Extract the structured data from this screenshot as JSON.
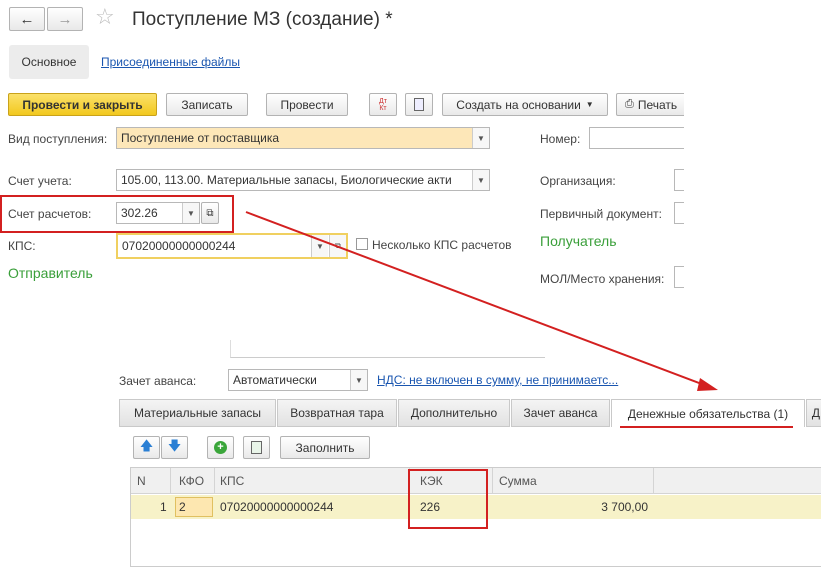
{
  "window": {
    "title": "Поступление МЗ (создание) *"
  },
  "tabs_top": {
    "main": "Основное",
    "files": "Присоединенные файлы"
  },
  "toolbar": {
    "post_close": "Провести и закрыть",
    "save": "Записать",
    "post": "Провести",
    "create_based": "Создать на основании",
    "print": "Печать"
  },
  "form": {
    "receipt_type_label": "Вид поступления:",
    "receipt_type_value": "Поступление от поставщика",
    "account_label": "Счет учета:",
    "account_value": "105.00, 113.00. Материальные запасы, Биологические акти",
    "settle_label": "Счет расчетов:",
    "settle_value": "302.26",
    "kps_label": "КПС:",
    "kps_value": "07020000000000244",
    "multi_kps_label": "Несколько КПС расчетов",
    "sender_label": "Отправитель",
    "number_label": "Номер:",
    "org_label": "Организация:",
    "primary_doc_label": "Первичный документ:",
    "recipient_label": "Получатель",
    "mol_label": "МОЛ/Место хранения:",
    "advance_label": "Зачет аванса:",
    "advance_value": "Автоматически",
    "vat_link": "НДС: не включен в сумму, не принимаетс..."
  },
  "bottom_tabs": [
    "Материальные запасы",
    "Возвратная тара",
    "Дополнительно",
    "Зачет аванса",
    "Денежные обязательства (1)",
    "Д"
  ],
  "table_toolbar": {
    "fill": "Заполнить"
  },
  "table": {
    "headers": [
      "N",
      "КФО",
      "КПС",
      "КЭК",
      "Сумма"
    ],
    "rows": [
      {
        "n": "1",
        "kfo": "2",
        "kps": "07020000000000244",
        "kek": "226",
        "sum": "3 700,00"
      }
    ]
  },
  "colors": {
    "accent_yellow": "#f5d03c",
    "highlight_red": "#d32020",
    "link_blue": "#1a56b0",
    "green": "#3a9f3a"
  }
}
